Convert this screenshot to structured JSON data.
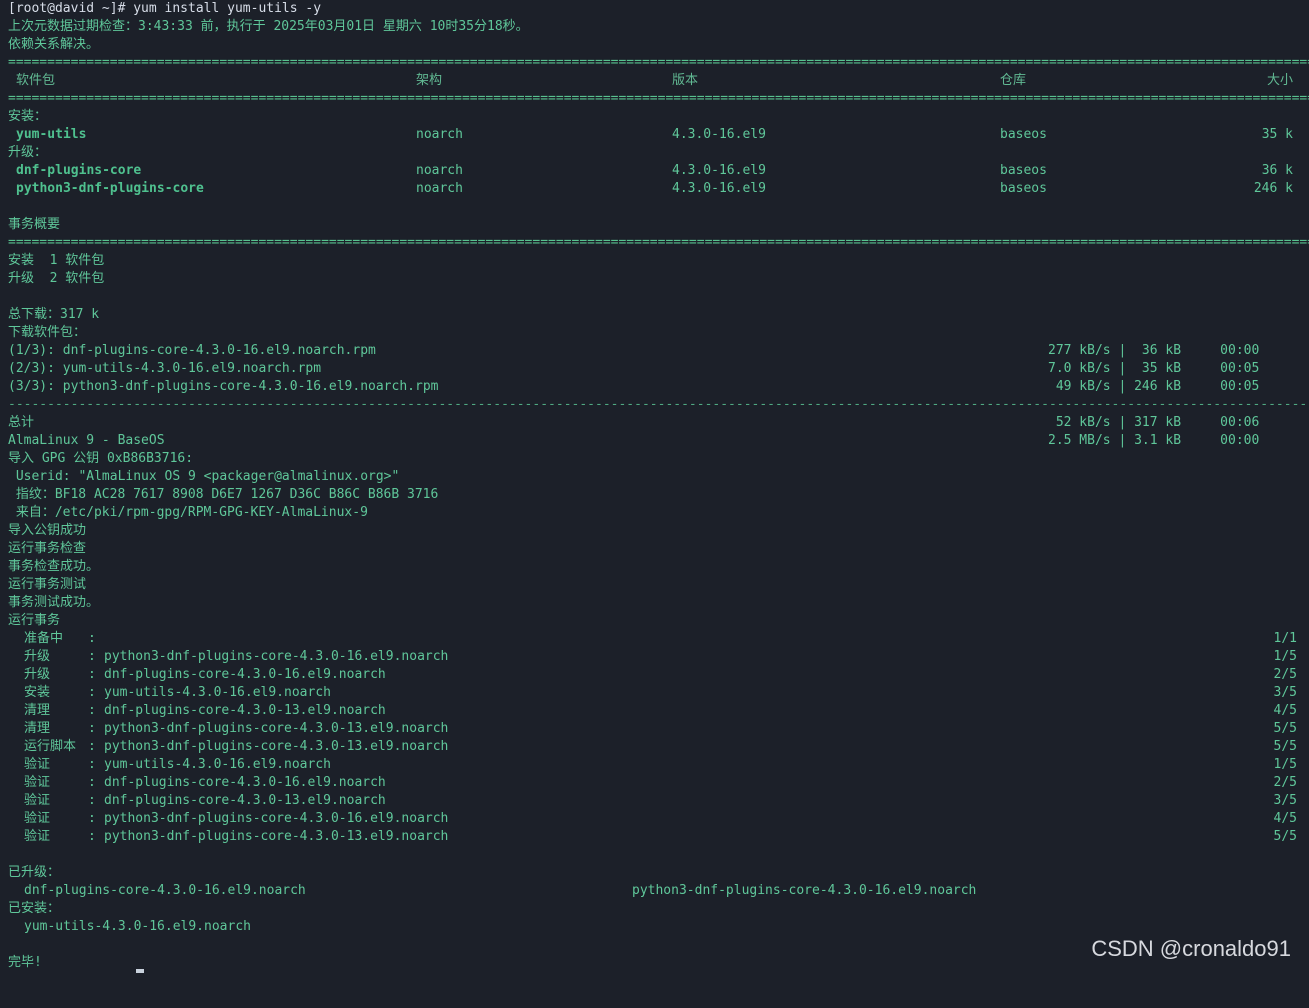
{
  "prompt": "[root@david ~]# yum install yum-utils -y",
  "metadata_line": "上次元数据过期检查：3:43:33 前，执行于 2025年03月01日 星期六 10时35分18秒。",
  "dep_resolved": "依赖关系解决。",
  "rule_equals": "===================================================================================================================================================================================================",
  "rule_dashes": "---------------------------------------------------------------------------------------------------------------------------------------------------------------------------------------------------",
  "table": {
    "headers": {
      "package": "软件包",
      "arch": "架构",
      "version": "版本",
      "repo": "仓库",
      "size": "大小"
    },
    "install_label": "安装：",
    "upgrade_label": "升级：",
    "install_rows": [
      {
        "name": "yum-utils",
        "arch": "noarch",
        "version": "4.3.0-16.el9",
        "repo": "baseos",
        "size": "35 k"
      }
    ],
    "upgrade_rows": [
      {
        "name": "dnf-plugins-core",
        "arch": "noarch",
        "version": "4.3.0-16.el9",
        "repo": "baseos",
        "size": "36 k"
      },
      {
        "name": "python3-dnf-plugins-core",
        "arch": "noarch",
        "version": "4.3.0-16.el9",
        "repo": "baseos",
        "size": "246 k"
      }
    ]
  },
  "summary": {
    "title": "事务概要",
    "install_line": "安装  1 软件包",
    "upgrade_line": "升级  2 软件包",
    "total_download": "总下载：317 k",
    "downloading": "下载软件包："
  },
  "downloads": [
    {
      "label": "(1/3): dnf-plugins-core-4.3.0-16.el9.noarch.rpm",
      "stats": "277 kB/s |  36 kB     00:00"
    },
    {
      "label": "(2/3): yum-utils-4.3.0-16.el9.noarch.rpm",
      "stats": "7.0 kB/s |  35 kB     00:05"
    },
    {
      "label": "(3/3): python3-dnf-plugins-core-4.3.0-16.el9.noarch.rpm",
      "stats": " 49 kB/s | 246 kB     00:05"
    }
  ],
  "totals": [
    {
      "label": "总计",
      "stats": " 52 kB/s | 317 kB     00:06"
    },
    {
      "label": "AlmaLinux 9 - BaseOS",
      "stats": "2.5 MB/s | 3.1 kB     00:00"
    }
  ],
  "gpg": {
    "import": "导入 GPG 公钥 0xB86B3716:",
    "userid": " Userid: \"AlmaLinux OS 9 <packager@almalinux.org>\"",
    "fingerprint": " 指纹：BF18 AC28 7617 8908 D6E7 1267 D36C B86C B86B 3716",
    "source": " 来自：/etc/pki/rpm-gpg/RPM-GPG-KEY-AlmaLinux-9",
    "success": "导入公钥成功"
  },
  "tx_lines": [
    "运行事务检查",
    "事务检查成功。",
    "运行事务测试",
    "事务测试成功。",
    "运行事务"
  ],
  "tx_steps": [
    {
      "action": "准备中  ",
      "pkg": "",
      "count": "1/1"
    },
    {
      "action": "升级    ",
      "pkg": "python3-dnf-plugins-core-4.3.0-16.el9.noarch",
      "count": "1/5"
    },
    {
      "action": "升级    ",
      "pkg": "dnf-plugins-core-4.3.0-16.el9.noarch",
      "count": "2/5"
    },
    {
      "action": "安装    ",
      "pkg": "yum-utils-4.3.0-16.el9.noarch",
      "count": "3/5"
    },
    {
      "action": "清理    ",
      "pkg": "dnf-plugins-core-4.3.0-13.el9.noarch",
      "count": "4/5"
    },
    {
      "action": "清理    ",
      "pkg": "python3-dnf-plugins-core-4.3.0-13.el9.noarch",
      "count": "5/5"
    },
    {
      "action": "运行脚本",
      "pkg": "python3-dnf-plugins-core-4.3.0-13.el9.noarch",
      "count": "5/5"
    },
    {
      "action": "验证    ",
      "pkg": "yum-utils-4.3.0-16.el9.noarch",
      "count": "1/5"
    },
    {
      "action": "验证    ",
      "pkg": "dnf-plugins-core-4.3.0-16.el9.noarch",
      "count": "2/5"
    },
    {
      "action": "验证    ",
      "pkg": "dnf-plugins-core-4.3.0-13.el9.noarch",
      "count": "3/5"
    },
    {
      "action": "验证    ",
      "pkg": "python3-dnf-plugins-core-4.3.0-16.el9.noarch",
      "count": "4/5"
    },
    {
      "action": "验证    ",
      "pkg": "python3-dnf-plugins-core-4.3.0-13.el9.noarch",
      "count": "5/5"
    }
  ],
  "upgraded": {
    "label": "已升级：",
    "pkg1": "dnf-plugins-core-4.3.0-16.el9.noarch",
    "pkg2": "python3-dnf-plugins-core-4.3.0-16.el9.noarch"
  },
  "installed": {
    "label": "已安装：",
    "pkg1": "yum-utils-4.3.0-16.el9.noarch"
  },
  "done": "完毕!",
  "watermark": "CSDN @cronaldo91"
}
